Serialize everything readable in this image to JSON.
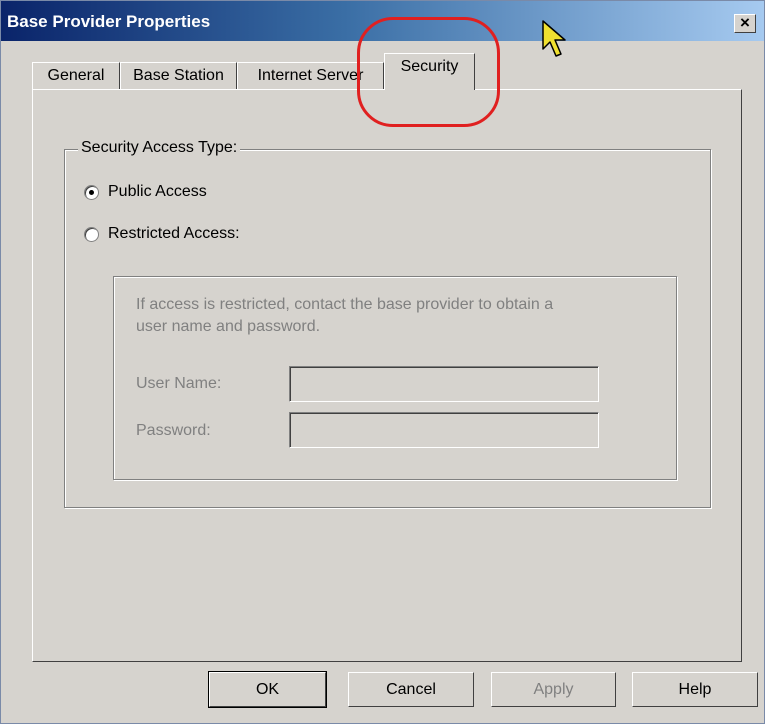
{
  "window": {
    "title": "Base Provider Properties",
    "close_label": "×"
  },
  "tabs": [
    {
      "label": "General"
    },
    {
      "label": "Base Station"
    },
    {
      "label": "Internet Server"
    },
    {
      "label": "Security"
    }
  ],
  "active_tab": "Security",
  "security": {
    "group_label": "Security Access Type:",
    "options": [
      {
        "label": "Public Access",
        "checked": true
      },
      {
        "label": "Restricted Access:",
        "checked": false
      }
    ],
    "restricted": {
      "info_line1": "If access is restricted, contact the base provider to obtain a",
      "info_line2": "user name and password.",
      "username_label": "User Name:",
      "username_value": "",
      "password_label": "Password:",
      "password_value": ""
    }
  },
  "buttons": {
    "ok": "OK",
    "cancel": "Cancel",
    "apply": "Apply",
    "help": "Help"
  },
  "colors": {
    "annotation": "#e02020",
    "disabled_text": "#808080",
    "titlebar_start": "#0a246a",
    "titlebar_end": "#a6caf0"
  }
}
